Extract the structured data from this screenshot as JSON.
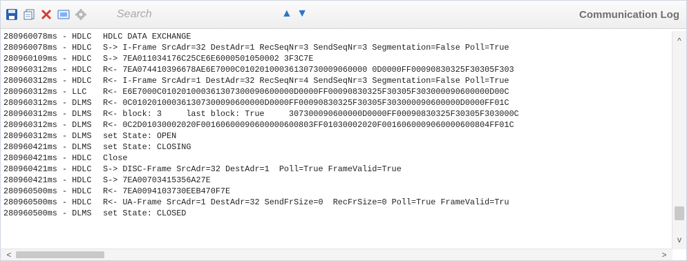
{
  "toolbar": {
    "icons": [
      "save-icon",
      "copy-icon",
      "delete-icon",
      "screenshot-icon",
      "settings-icon"
    ],
    "search_placeholder": "Search",
    "nav_up": "▲",
    "nav_down": "▼",
    "window_title": "Communication Log",
    "colors": {
      "save": "#2a5fb0",
      "delete": "#d93a2f",
      "accent": "#2f74c4"
    }
  },
  "log": {
    "rows": [
      {
        "ts": "280960078ms - HDLC",
        "msg": "HDLC DATA EXCHANGE"
      },
      {
        "ts": "280960078ms - HDLC",
        "msg": "S-> I-Frame SrcAdr=32 DestAdr=1 RecSeqNr=3 SendSeqNr=3 Segmentation=False Poll=True"
      },
      {
        "ts": "280960109ms - HDLC",
        "msg": "S-> 7EA011034176C25CE6E6000501050002 3F3C7E"
      },
      {
        "ts": "280960312ms - HDLC",
        "msg": "R<- 7EA074410396678AE6E7000C01020100036130730009060000 0D0000FF00090830325F30305F303"
      },
      {
        "ts": "280960312ms - HDLC",
        "msg": "R<- I-Frame SrcAdr=1 DestAdr=32 RecSeqNr=4 SendSeqNr=3 Segmentation=False Poll=True"
      },
      {
        "ts": "280960312ms - LLC",
        "msg": "R<- E6E7000C010201000361307300090600000D0000FF00090830325F30305F303000090600000D00C"
      },
      {
        "ts": "280960312ms - DLMS",
        "msg": "R<- 0C010201000361307300090600000D0000FF00090830325F30305F303000090600000D0000FF01C"
      },
      {
        "ts": "280960312ms - DLMS",
        "msg": "R<- block: 3     last block: True     307300090600000D0000FF00090830325F30305F303000C"
      },
      {
        "ts": "280960312ms - DLMS",
        "msg": "R<- 0C2D01030002020F00160600090600000600803FF01030002020F0016060009060000600804FF01C"
      },
      {
        "ts": "280960312ms - DLMS",
        "msg": "set State: OPEN"
      },
      {
        "ts": "280960421ms - DLMS",
        "msg": "set State: CLOSING"
      },
      {
        "ts": "280960421ms - HDLC",
        "msg": "Close"
      },
      {
        "ts": "280960421ms - HDLC",
        "msg": "S-> DISC-Frame SrcAdr=32 DestAdr=1  Poll=True FrameValid=True"
      },
      {
        "ts": "280960421ms - HDLC",
        "msg": "S-> 7EA00703415356A27E"
      },
      {
        "ts": "280960500ms - HDLC",
        "msg": "R<- 7EA0094103730EEB470F7E"
      },
      {
        "ts": "280960500ms - HDLC",
        "msg": "R<- UA-Frame SrcAdr=1 DestAdr=32 SendFrSize=0  RecFrSize=0 Poll=True FrameValid=Tru"
      },
      {
        "ts": "280960500ms - DLMS",
        "msg": "set State: CLOSED"
      }
    ]
  },
  "scrollbars": {
    "up": "^",
    "down": "v",
    "left": "<",
    "right": ">"
  }
}
